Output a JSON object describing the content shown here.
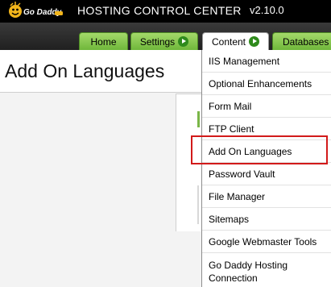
{
  "header": {
    "logo_text": "Go Daddy",
    "app_title": "HOSTING CONTROL CENTER",
    "version": "v2.10.0"
  },
  "nav": {
    "tabs": [
      {
        "label": "Home",
        "has_arrow": false
      },
      {
        "label": "Settings",
        "has_arrow": true
      },
      {
        "label": "Content",
        "has_arrow": true,
        "active": true
      },
      {
        "label": "Databases",
        "has_arrow": false
      }
    ]
  },
  "page": {
    "title": "Add On Languages"
  },
  "content_menu": {
    "items": [
      {
        "label": "IIS Management"
      },
      {
        "label": "Optional Enhancements"
      },
      {
        "label": "Form Mail"
      },
      {
        "label": "FTP Client"
      },
      {
        "label": "Add On Languages",
        "highlighted": true
      },
      {
        "label": "Password Vault"
      },
      {
        "label": "File Manager"
      },
      {
        "label": "Sitemaps"
      },
      {
        "label": "Google Webmaster Tools"
      },
      {
        "label_line1": "Go Daddy Hosting",
        "label_line2": "Connection"
      }
    ]
  },
  "colors": {
    "tab_green": "#7ab648",
    "highlight_red": "#d21a1a",
    "header_black": "#000000"
  }
}
